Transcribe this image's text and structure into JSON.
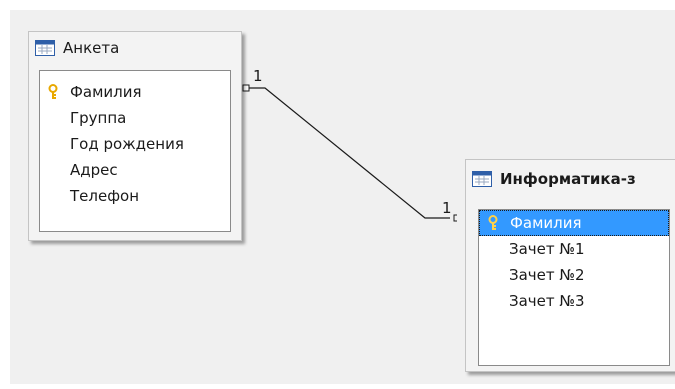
{
  "tables": [
    {
      "title": "Анкета",
      "icon": "table-icon",
      "fields": [
        {
          "label": "Фамилия",
          "primary_key": true,
          "selected": false
        },
        {
          "label": "Группа",
          "primary_key": false,
          "selected": false
        },
        {
          "label": "Год рождения",
          "primary_key": false,
          "selected": false
        },
        {
          "label": "Адрес",
          "primary_key": false,
          "selected": false
        },
        {
          "label": "Телефон",
          "primary_key": false,
          "selected": false
        }
      ]
    },
    {
      "title": "Информатика-з",
      "icon": "table-icon",
      "fields": [
        {
          "label": "Фамилия",
          "primary_key": true,
          "selected": true
        },
        {
          "label": "Зачет №1",
          "primary_key": false,
          "selected": false
        },
        {
          "label": "Зачет №2",
          "primary_key": false,
          "selected": false
        },
        {
          "label": "Зачет №3",
          "primary_key": false,
          "selected": false
        }
      ]
    }
  ],
  "relationship": {
    "from_cardinality": "1",
    "to_cardinality": "1"
  },
  "colors": {
    "canvas_bg": "#f0f0f0",
    "selection": "#3399ff",
    "key_icon": "#e8a800"
  }
}
